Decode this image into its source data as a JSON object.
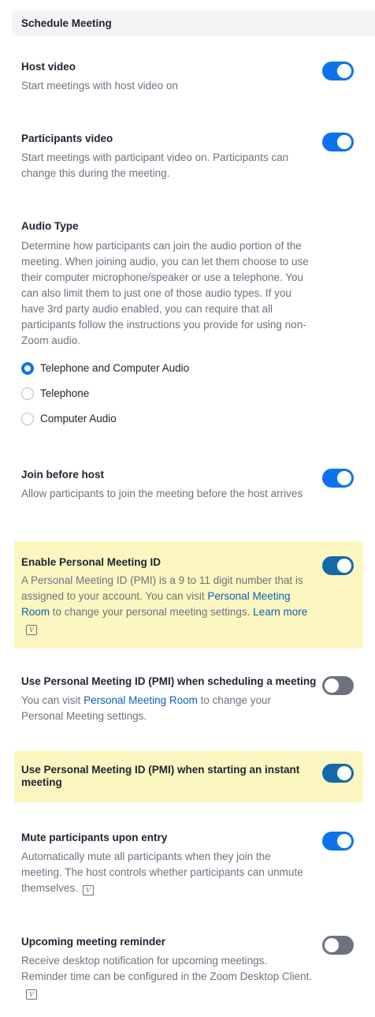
{
  "header": {
    "title": "Schedule Meeting"
  },
  "settings": {
    "host_video": {
      "title": "Host video",
      "desc": "Start meetings with host video on",
      "enabled": true
    },
    "participants_video": {
      "title": "Participants video",
      "desc": "Start meetings with participant video on. Participants can change this during the meeting.",
      "enabled": true
    },
    "audio_type": {
      "title": "Audio Type",
      "desc": "Determine how participants can join the audio portion of the meeting. When joining audio, you can let them choose to use their computer microphone/speaker or use a telephone. You can also limit them to just one of those audio types. If you have 3rd party audio enabled, you can require that all participants follow the instructions you provide for using non-Zoom audio.",
      "options": [
        "Telephone and Computer Audio",
        "Telephone",
        "Computer Audio"
      ],
      "selected": "Telephone and Computer Audio"
    },
    "join_before_host": {
      "title": "Join before host",
      "desc": "Allow participants to join the meeting before the host arrives",
      "enabled": true
    },
    "enable_pmi": {
      "title": "Enable Personal Meeting ID",
      "desc_part1": "A Personal Meeting ID (PMI) is a 9 to 11 digit number that is assigned to your account. You can visit ",
      "link1": "Personal Meeting Room",
      "desc_part2": " to change your personal meeting settings. ",
      "link2": "Learn more",
      "enabled": true,
      "icon": "v-badge-icon"
    },
    "pmi_scheduling": {
      "title": "Use Personal Meeting ID (PMI) when scheduling a meeting",
      "desc_part1": "You can visit ",
      "link1": "Personal Meeting Room",
      "desc_part2": " to change your Personal Meeting settings.",
      "enabled": false
    },
    "pmi_instant": {
      "title": "Use Personal Meeting ID (PMI) when starting an instant meeting",
      "enabled": true
    },
    "mute_on_entry": {
      "title": "Mute participants upon entry",
      "desc": "Automatically mute all participants when they join the meeting. The host controls whether participants can unmute themselves.",
      "enabled": true,
      "icon": "v-badge-icon"
    },
    "upcoming_reminder": {
      "title": "Upcoming meeting reminder",
      "desc": "Receive desktop notification for upcoming meetings. Reminder time can be configured in the Zoom Desktop Client.",
      "enabled": false,
      "icon": "v-badge-icon"
    }
  },
  "colors": {
    "accent": "#0e72ed",
    "link": "#0e5fb8",
    "highlight": "#fcf7c0",
    "toggle_off": "#6e7180"
  }
}
